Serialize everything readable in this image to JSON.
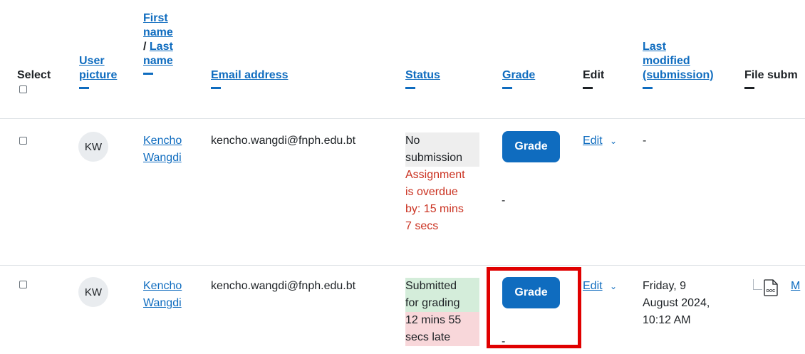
{
  "header": {
    "select_label": "Select",
    "user_picture_1": "User",
    "user_picture_2": "picture",
    "first_name_1": "First",
    "first_name_2": "name",
    "name_sep": "/ ",
    "last_name_1": "Last",
    "last_name_2": "name",
    "email": "Email address",
    "status": "Status",
    "grade": "Grade",
    "edit": "Edit",
    "last_modified_1": "Last",
    "last_modified_2": "modified",
    "last_modified_3": "(submission)",
    "file_submissions": "File subm"
  },
  "rows": [
    {
      "initials": "KW",
      "first_name": "Kencho",
      "last_name": "Wangdi",
      "email": "kencho.wangdi@fnph.edu.bt",
      "status_lines": [
        "No",
        "submission"
      ],
      "overdue_lines": [
        "Assignment",
        "is overdue",
        "by: 15 mins",
        "7 secs"
      ],
      "grade_button": "Grade",
      "grade_value": "-",
      "edit_label": "Edit",
      "last_modified": "-"
    },
    {
      "initials": "KW",
      "first_name": "Kencho",
      "last_name": "Wangdi",
      "email": "kencho.wangdi@fnph.edu.bt",
      "status_green_lines": [
        "Submitted",
        "for grading"
      ],
      "status_red_lines": [
        "12 mins 55",
        "secs late"
      ],
      "grade_button": "Grade",
      "grade_value": "-",
      "edit_label": "Edit",
      "last_modified_lines": [
        "Friday, 9",
        "August 2024,",
        "10:12 AM"
      ],
      "file_link": "M"
    }
  ],
  "colors": {
    "link": "#0f6cbf",
    "highlight_box": "#e00000",
    "overdue_text": "#ca3120"
  }
}
